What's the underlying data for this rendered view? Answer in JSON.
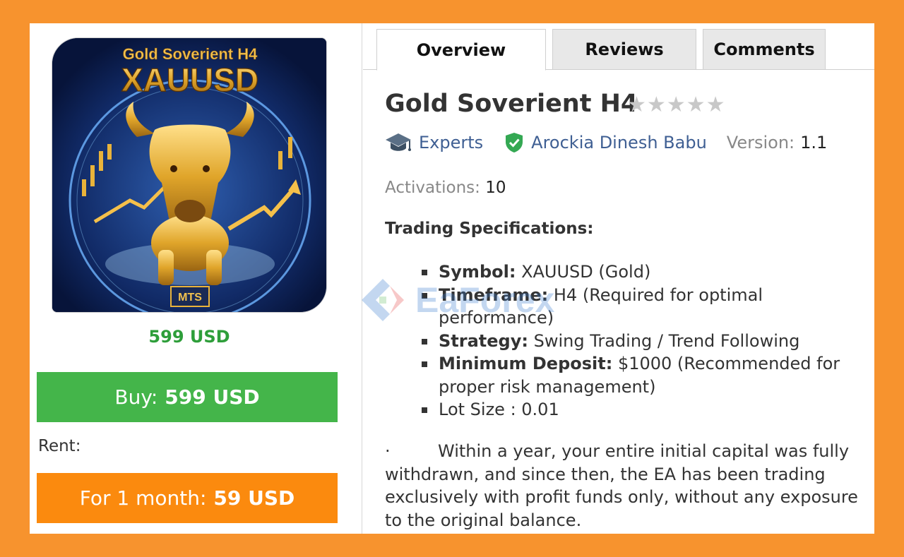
{
  "product": {
    "logo_text_top": "Gold Soverient H4",
    "logo_text_main": "XAUUSD",
    "logo_badge": "MTS",
    "price": "599 USD",
    "buy_label": "Buy:",
    "buy_price": "599 USD",
    "rent_label": "Rent:",
    "rent_button_label": "For 1 month:",
    "rent_button_price": "59 USD"
  },
  "tabs": [
    {
      "label": "Overview",
      "active": true
    },
    {
      "label": "Reviews",
      "active": false
    },
    {
      "label": "Comments",
      "active": false
    }
  ],
  "overview": {
    "title": "Gold Soverient H4",
    "rating_stars": "★★★★★",
    "rating_value": 0,
    "category": "Experts",
    "author": "Arockia Dinesh Babu",
    "version_label": "Version:",
    "version": "1.1",
    "activations_label": "Activations:",
    "activations": "10",
    "spec_title": "Trading Specifications:",
    "specs": [
      {
        "key": "Symbol:",
        "value": " XAUUSD (Gold)"
      },
      {
        "key": "Timeframe:",
        "value": " H4 (Required for optimal performance)"
      },
      {
        "key": "Strategy:",
        "value": " Swing Trading / Trend Following"
      },
      {
        "key": "Minimum Deposit:",
        "value": " $1000 (Recommended for proper risk management)"
      },
      {
        "key": "",
        "value": "Lot Size : 0.01"
      }
    ],
    "paragraph_bullet": "·",
    "paragraph": "Within a year, your entire initial capital was fully withdrawn, and since then, the EA has been trading exclusively with profit funds only, without any exposure to the original balance."
  },
  "watermark": "EaForex",
  "icons": {
    "category": "graduation-cap-icon",
    "author": "verified-shield-icon",
    "stars": "star-icon"
  },
  "colors": {
    "background": "#f7932e",
    "buy": "#44b54a",
    "rent": "#fb8a0e",
    "price": "#2e9e3a",
    "link": "#3f5f93"
  }
}
